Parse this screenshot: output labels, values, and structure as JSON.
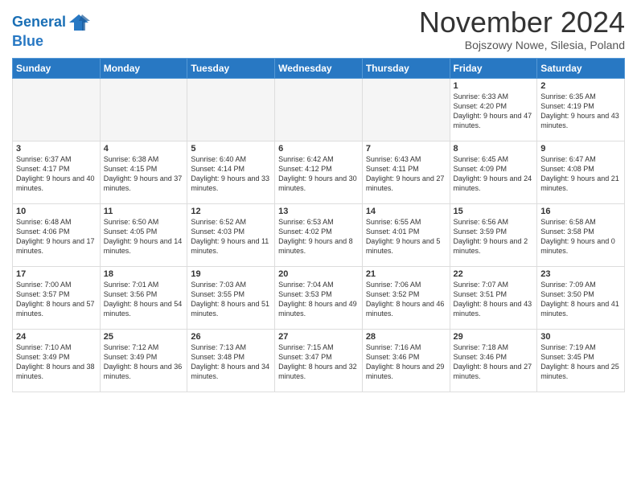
{
  "logo": {
    "line1": "General",
    "line2": "Blue"
  },
  "title": "November 2024",
  "location": "Bojszowy Nowe, Silesia, Poland",
  "days_of_week": [
    "Sunday",
    "Monday",
    "Tuesday",
    "Wednesday",
    "Thursday",
    "Friday",
    "Saturday"
  ],
  "weeks": [
    [
      {
        "day": "",
        "info": ""
      },
      {
        "day": "",
        "info": ""
      },
      {
        "day": "",
        "info": ""
      },
      {
        "day": "",
        "info": ""
      },
      {
        "day": "",
        "info": ""
      },
      {
        "day": "1",
        "info": "Sunrise: 6:33 AM\nSunset: 4:20 PM\nDaylight: 9 hours and 47 minutes."
      },
      {
        "day": "2",
        "info": "Sunrise: 6:35 AM\nSunset: 4:19 PM\nDaylight: 9 hours and 43 minutes."
      }
    ],
    [
      {
        "day": "3",
        "info": "Sunrise: 6:37 AM\nSunset: 4:17 PM\nDaylight: 9 hours and 40 minutes."
      },
      {
        "day": "4",
        "info": "Sunrise: 6:38 AM\nSunset: 4:15 PM\nDaylight: 9 hours and 37 minutes."
      },
      {
        "day": "5",
        "info": "Sunrise: 6:40 AM\nSunset: 4:14 PM\nDaylight: 9 hours and 33 minutes."
      },
      {
        "day": "6",
        "info": "Sunrise: 6:42 AM\nSunset: 4:12 PM\nDaylight: 9 hours and 30 minutes."
      },
      {
        "day": "7",
        "info": "Sunrise: 6:43 AM\nSunset: 4:11 PM\nDaylight: 9 hours and 27 minutes."
      },
      {
        "day": "8",
        "info": "Sunrise: 6:45 AM\nSunset: 4:09 PM\nDaylight: 9 hours and 24 minutes."
      },
      {
        "day": "9",
        "info": "Sunrise: 6:47 AM\nSunset: 4:08 PM\nDaylight: 9 hours and 21 minutes."
      }
    ],
    [
      {
        "day": "10",
        "info": "Sunrise: 6:48 AM\nSunset: 4:06 PM\nDaylight: 9 hours and 17 minutes."
      },
      {
        "day": "11",
        "info": "Sunrise: 6:50 AM\nSunset: 4:05 PM\nDaylight: 9 hours and 14 minutes."
      },
      {
        "day": "12",
        "info": "Sunrise: 6:52 AM\nSunset: 4:03 PM\nDaylight: 9 hours and 11 minutes."
      },
      {
        "day": "13",
        "info": "Sunrise: 6:53 AM\nSunset: 4:02 PM\nDaylight: 9 hours and 8 minutes."
      },
      {
        "day": "14",
        "info": "Sunrise: 6:55 AM\nSunset: 4:01 PM\nDaylight: 9 hours and 5 minutes."
      },
      {
        "day": "15",
        "info": "Sunrise: 6:56 AM\nSunset: 3:59 PM\nDaylight: 9 hours and 2 minutes."
      },
      {
        "day": "16",
        "info": "Sunrise: 6:58 AM\nSunset: 3:58 PM\nDaylight: 9 hours and 0 minutes."
      }
    ],
    [
      {
        "day": "17",
        "info": "Sunrise: 7:00 AM\nSunset: 3:57 PM\nDaylight: 8 hours and 57 minutes."
      },
      {
        "day": "18",
        "info": "Sunrise: 7:01 AM\nSunset: 3:56 PM\nDaylight: 8 hours and 54 minutes."
      },
      {
        "day": "19",
        "info": "Sunrise: 7:03 AM\nSunset: 3:55 PM\nDaylight: 8 hours and 51 minutes."
      },
      {
        "day": "20",
        "info": "Sunrise: 7:04 AM\nSunset: 3:53 PM\nDaylight: 8 hours and 49 minutes."
      },
      {
        "day": "21",
        "info": "Sunrise: 7:06 AM\nSunset: 3:52 PM\nDaylight: 8 hours and 46 minutes."
      },
      {
        "day": "22",
        "info": "Sunrise: 7:07 AM\nSunset: 3:51 PM\nDaylight: 8 hours and 43 minutes."
      },
      {
        "day": "23",
        "info": "Sunrise: 7:09 AM\nSunset: 3:50 PM\nDaylight: 8 hours and 41 minutes."
      }
    ],
    [
      {
        "day": "24",
        "info": "Sunrise: 7:10 AM\nSunset: 3:49 PM\nDaylight: 8 hours and 38 minutes."
      },
      {
        "day": "25",
        "info": "Sunrise: 7:12 AM\nSunset: 3:49 PM\nDaylight: 8 hours and 36 minutes."
      },
      {
        "day": "26",
        "info": "Sunrise: 7:13 AM\nSunset: 3:48 PM\nDaylight: 8 hours and 34 minutes."
      },
      {
        "day": "27",
        "info": "Sunrise: 7:15 AM\nSunset: 3:47 PM\nDaylight: 8 hours and 32 minutes."
      },
      {
        "day": "28",
        "info": "Sunrise: 7:16 AM\nSunset: 3:46 PM\nDaylight: 8 hours and 29 minutes."
      },
      {
        "day": "29",
        "info": "Sunrise: 7:18 AM\nSunset: 3:46 PM\nDaylight: 8 hours and 27 minutes."
      },
      {
        "day": "30",
        "info": "Sunrise: 7:19 AM\nSunset: 3:45 PM\nDaylight: 8 hours and 25 minutes."
      }
    ]
  ]
}
